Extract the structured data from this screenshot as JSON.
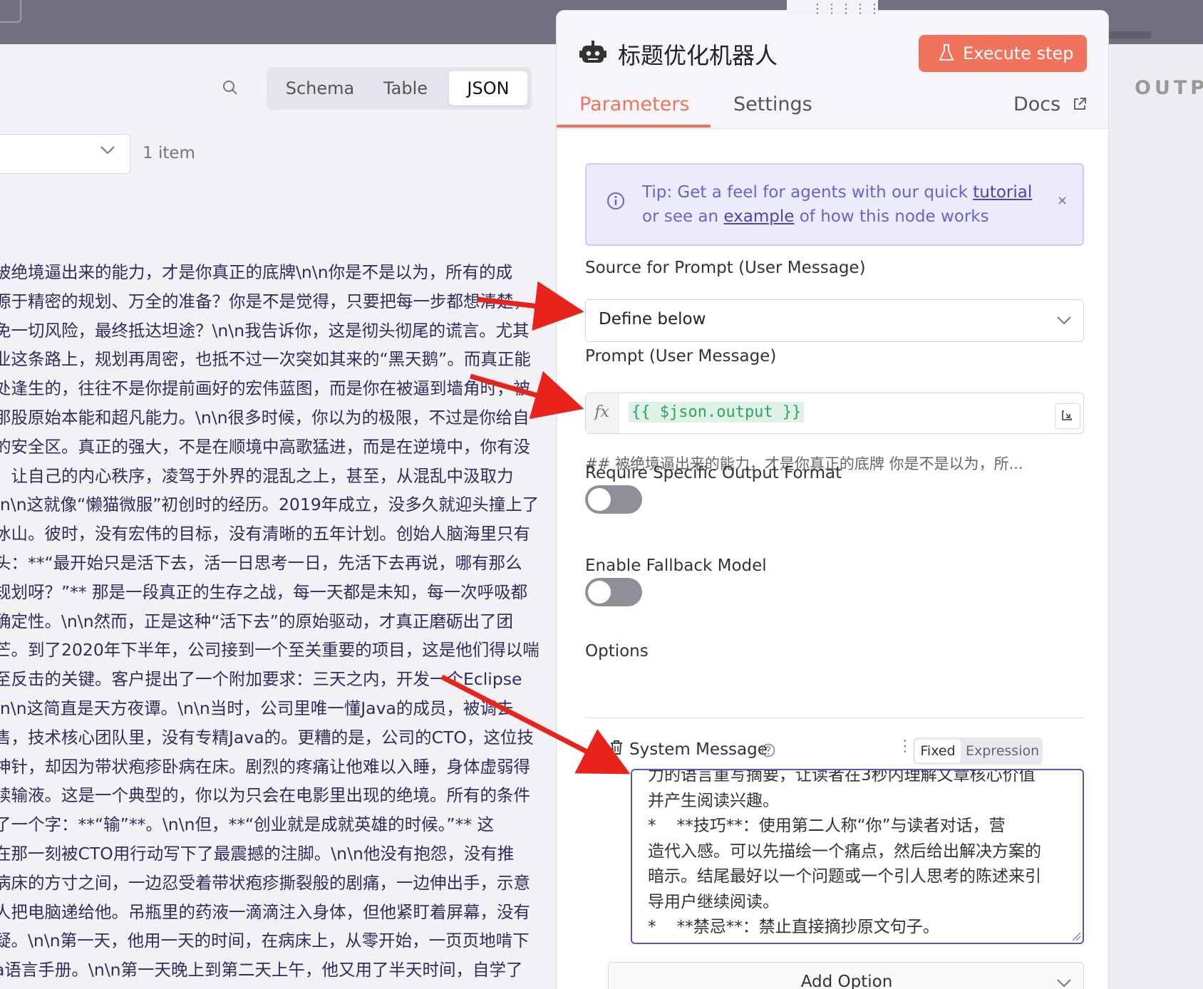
{
  "input_panel": {
    "view_tabs": [
      "Schema",
      "Table",
      "JSON"
    ],
    "active_view": "JSON",
    "item_count": "1 item",
    "json_lines": [
      "被绝境逼出来的能力，才是你真正的底牌\\n\\n你是不是以为，所有的成",
      "源于精密的规划、万全的准备？你是不是觉得，只要把每一步都想清楚，",
      "免一切风险，最终抵达坦途？\\n\\n我告诉你，这是彻头彻尾的谎言。尤其",
      "业这条路上，规划再周密，也抵不过一次突如其来的“黑天鹅”。而真正能",
      "处逢生的，往往不是你提前画好的宏伟蓝图，而是你在被逼到墙角时，被",
      "那股原始本能和超凡能力。\\n\\n很多时候，你以为的极限，不过是你给自",
      "的安全区。真正的强大，不是在顺境中高歌猛进，而是在逆境中，你有没",
      "，让自己的内心秩序，凌驾于外界的混乱之上，甚至，从混乱中汲取力",
      "\\n\\n这就像“懒猫微服”初创时的经历。2019年成立，没多久就迎头撞上了",
      "冰山。彼时，没有宏伟的目标，没有清晰的五年计划。创始人脑海里只有",
      "头：**“最开始只是活下去，活一日思考一日，先活下去再说，哪有那么",
      "规划呀？”** 那是一段真正的生存之战，每一天都是未知，每一次呼吸都",
      "确定性。\\n\\n然而，正是这种“活下去”的原始驱动，才真正磨砺出了团",
      "芒。到了2020年下半年，公司接到一个至关重要的项目，这是他们得以喘",
      "至反击的关键。客户提出了一个附加要求：三天之内，开发一个Eclipse",
      "\\n\\n这简直是天方夜谭。\\n\\n当时，公司里唯一懂Java的成员，被调去",
      "售，技术核心团队里，没有专精Java的。更糟的是，公司的CTO，这位技",
      "神针，却因为带状疱疹卧病在床。剧烈的疼痛让他难以入睡，身体虚弱得",
      "续输液。这是一个典型的，你以为只会在电影里出现的绝境。所有的条件",
      "了一个字：**“输”**。\\n\\n但，**“创业就是成就英雄的时候。”** 这",
      "在那一刻被CTO用行动写下了最震撼的注脚。\\n\\n他没有抱怨，没有推",
      "病床的方寸之间，一边忍受着带状疱疹撕裂般的剧痛，一边伸出手，示意",
      "人把电脑递给他。吊瓶里的药液一滴滴注入身体，但他紧盯着屏幕，没有",
      "疑。\\n\\n第一天，他用一天的时间，在病床上，从零开始，一页页地啃下",
      "a语言手册。\\n\\n第一天晚上到第二天上午，他又用了半天时间，自学了"
    ]
  },
  "output_panel": {
    "label": "OUTP"
  },
  "node": {
    "title": "标题优化机器人",
    "execute_label": "Execute step",
    "tabs": {
      "parameters": "Parameters",
      "settings": "Settings",
      "docs": "Docs"
    },
    "tip": {
      "prefix": "Tip: Get a feel for agents with our quick ",
      "tutorial_link": "tutorial",
      "middle": "or see an ",
      "example_link": "example",
      "suffix": " of how this node works",
      "close": "×"
    },
    "source_prompt": {
      "label": "Source for Prompt (User Message)",
      "value": "Define below"
    },
    "prompt": {
      "label": "Prompt (User Message)",
      "fx": "fx",
      "expression": "{{ $json.output }}",
      "preview": "## 被绝境逼出来的能力，才是你真正的底牌 你是不是以为，所..."
    },
    "require_output_format": {
      "label": "Require Specific Output Format",
      "enabled": false
    },
    "enable_fallback": {
      "label": "Enable Fallback Model",
      "enabled": false
    },
    "options": {
      "label": "Options",
      "system_message": {
        "label": "System Message",
        "mode_fixed": "Fixed",
        "mode_expression": "Expression",
        "text": "力的语言重写摘要，让读者在3秒内理解文章核心价值\n并产生阅读兴趣。\n*    **技巧**：使用第二人称“你”与读者对话，营\n造代入感。可以先描绘一个痛点，然后给出解决方案的\n暗示。结尾最好以一个问题或一个引人思考的陈述来引\n导用户继续阅读。\n*    **禁忌**：禁止直接摘抄原文句子。"
      },
      "add_option": "Add Option"
    }
  },
  "colors": {
    "accent": "#f2735b",
    "tip_text": "#6a63c9",
    "expression_green": "#2ea36a",
    "annotation_arrow": "#e8231b"
  }
}
